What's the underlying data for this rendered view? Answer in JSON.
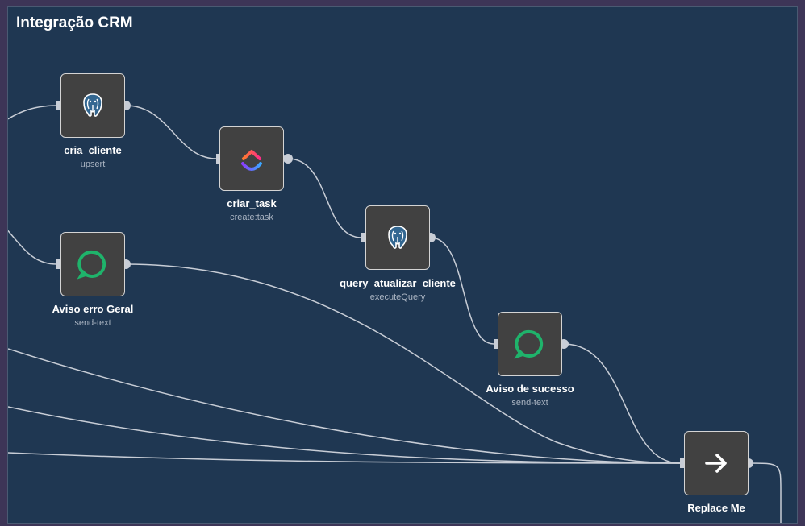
{
  "group": {
    "title": "Integração CRM"
  },
  "nodes": [
    {
      "id": "cria_cliente",
      "label": "cria_cliente",
      "subtitle": "upsert",
      "icon": "postgres-icon"
    },
    {
      "id": "criar_task",
      "label": "criar_task",
      "subtitle": "create:task",
      "icon": "clickup-icon"
    },
    {
      "id": "query_atualizar_cliente",
      "label": "query_atualizar_cliente",
      "subtitle": "executeQuery",
      "icon": "postgres-icon"
    },
    {
      "id": "aviso_erro_geral",
      "label": "Aviso erro Geral",
      "subtitle": "send-text",
      "icon": "chat-bubble-icon"
    },
    {
      "id": "aviso_de_sucesso",
      "label": "Aviso de sucesso",
      "subtitle": "send-text",
      "icon": "chat-bubble-icon"
    },
    {
      "id": "replace_me",
      "label": "Replace Me",
      "subtitle": "",
      "icon": "arrow-right-icon"
    }
  ],
  "colors": {
    "canvas": "#1f3752",
    "frame": "#3d3557",
    "node_fill": "#414141",
    "node_border": "#d4d4d4",
    "edge": "#c8cdd6",
    "chat_green": "#1fb36b"
  }
}
